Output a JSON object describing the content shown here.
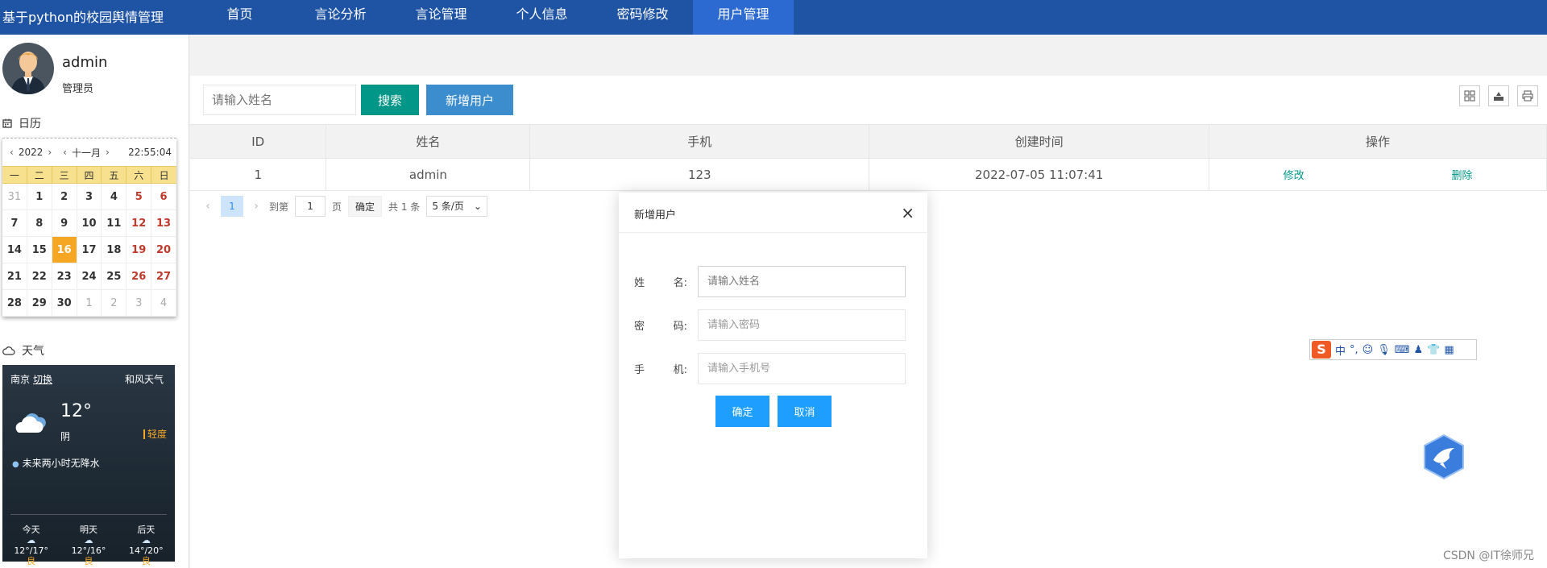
{
  "brand": "基于python的校园舆情管理",
  "nav": [
    {
      "label": "首页"
    },
    {
      "label": "言论分析"
    },
    {
      "label": "言论管理"
    },
    {
      "label": "个人信息"
    },
    {
      "label": "密码修改"
    },
    {
      "label": "用户管理",
      "active": true
    }
  ],
  "user": {
    "name": "admin",
    "role": "管理员"
  },
  "calendar": {
    "title": "日历",
    "year": "2022",
    "month": "十一月",
    "time": "22:55:04",
    "weekdays": [
      "一",
      "二",
      "三",
      "四",
      "五",
      "六",
      "日"
    ],
    "days": [
      "31",
      "1",
      "2",
      "3",
      "4",
      "5",
      "6",
      "7",
      "8",
      "9",
      "10",
      "11",
      "12",
      "13",
      "14",
      "15",
      "16",
      "17",
      "18",
      "19",
      "20",
      "21",
      "22",
      "23",
      "24",
      "25",
      "26",
      "27",
      "28",
      "29",
      "30",
      "1",
      "2",
      "3",
      "4"
    ],
    "today": "16"
  },
  "weather": {
    "title": "天气",
    "city": "南京",
    "switch": "切换",
    "brand": "和风天气",
    "temp": "12°",
    "condition": "阴",
    "aqi": "轻度",
    "rain": "未来两小时无降水",
    "forecast": [
      {
        "day": "今天",
        "range": "12°/17°",
        "quality": "良"
      },
      {
        "day": "明天",
        "range": "12°/16°",
        "quality": "良"
      },
      {
        "day": "后天",
        "range": "14°/20°",
        "quality": "良"
      }
    ]
  },
  "toolbar": {
    "search_placeholder": "请输入姓名",
    "search_label": "搜索",
    "add_label": "新增用户"
  },
  "table": {
    "columns": [
      "ID",
      "姓名",
      "手机",
      "创建时间",
      "操作"
    ],
    "rows": [
      {
        "id": "1",
        "name": "admin",
        "phone": "123",
        "created": "2022-07-05 11:07:41",
        "edit": "修改",
        "delete": "删除"
      }
    ]
  },
  "pager": {
    "page": "1",
    "goto_label": "到第",
    "goto_value": "1",
    "page_unit": "页",
    "confirm": "确定",
    "total": "共 1 条",
    "page_size": "5 条/页"
  },
  "modal": {
    "title": "新增用户",
    "close": "×",
    "fields": [
      {
        "label_a": "姓",
        "label_b": "名:",
        "placeholder": "请输入姓名"
      },
      {
        "label_a": "密",
        "label_b": "码:",
        "placeholder": "请输入密码"
      },
      {
        "label_a": "手",
        "label_b": "机:",
        "placeholder": "请输入手机号"
      }
    ],
    "ok": "确定",
    "cancel": "取消"
  },
  "ime": {
    "logo": "S",
    "mode": "中"
  },
  "watermark": "CSDN @IT徐师兄",
  "colors": {
    "topbar": "#1f54a5",
    "nav_active": "#2c6ad1",
    "search_btn": "#009688",
    "add_btn": "#3c8dce",
    "modal_btn": "#1e9fff",
    "today": "#f5a623"
  }
}
